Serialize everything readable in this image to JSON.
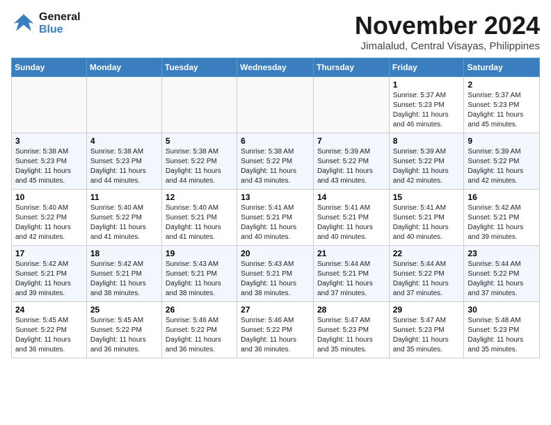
{
  "logo": {
    "line1": "General",
    "line2": "Blue"
  },
  "title": "November 2024",
  "subtitle": "Jimalalud, Central Visayas, Philippines",
  "days_of_week": [
    "Sunday",
    "Monday",
    "Tuesday",
    "Wednesday",
    "Thursday",
    "Friday",
    "Saturday"
  ],
  "weeks": [
    [
      {
        "day": "",
        "info": ""
      },
      {
        "day": "",
        "info": ""
      },
      {
        "day": "",
        "info": ""
      },
      {
        "day": "",
        "info": ""
      },
      {
        "day": "",
        "info": ""
      },
      {
        "day": "1",
        "info": "Sunrise: 5:37 AM\nSunset: 5:23 PM\nDaylight: 11 hours and 46 minutes."
      },
      {
        "day": "2",
        "info": "Sunrise: 5:37 AM\nSunset: 5:23 PM\nDaylight: 11 hours and 45 minutes."
      }
    ],
    [
      {
        "day": "3",
        "info": "Sunrise: 5:38 AM\nSunset: 5:23 PM\nDaylight: 11 hours and 45 minutes."
      },
      {
        "day": "4",
        "info": "Sunrise: 5:38 AM\nSunset: 5:23 PM\nDaylight: 11 hours and 44 minutes."
      },
      {
        "day": "5",
        "info": "Sunrise: 5:38 AM\nSunset: 5:22 PM\nDaylight: 11 hours and 44 minutes."
      },
      {
        "day": "6",
        "info": "Sunrise: 5:38 AM\nSunset: 5:22 PM\nDaylight: 11 hours and 43 minutes."
      },
      {
        "day": "7",
        "info": "Sunrise: 5:39 AM\nSunset: 5:22 PM\nDaylight: 11 hours and 43 minutes."
      },
      {
        "day": "8",
        "info": "Sunrise: 5:39 AM\nSunset: 5:22 PM\nDaylight: 11 hours and 42 minutes."
      },
      {
        "day": "9",
        "info": "Sunrise: 5:39 AM\nSunset: 5:22 PM\nDaylight: 11 hours and 42 minutes."
      }
    ],
    [
      {
        "day": "10",
        "info": "Sunrise: 5:40 AM\nSunset: 5:22 PM\nDaylight: 11 hours and 42 minutes."
      },
      {
        "day": "11",
        "info": "Sunrise: 5:40 AM\nSunset: 5:22 PM\nDaylight: 11 hours and 41 minutes."
      },
      {
        "day": "12",
        "info": "Sunrise: 5:40 AM\nSunset: 5:21 PM\nDaylight: 11 hours and 41 minutes."
      },
      {
        "day": "13",
        "info": "Sunrise: 5:41 AM\nSunset: 5:21 PM\nDaylight: 11 hours and 40 minutes."
      },
      {
        "day": "14",
        "info": "Sunrise: 5:41 AM\nSunset: 5:21 PM\nDaylight: 11 hours and 40 minutes."
      },
      {
        "day": "15",
        "info": "Sunrise: 5:41 AM\nSunset: 5:21 PM\nDaylight: 11 hours and 40 minutes."
      },
      {
        "day": "16",
        "info": "Sunrise: 5:42 AM\nSunset: 5:21 PM\nDaylight: 11 hours and 39 minutes."
      }
    ],
    [
      {
        "day": "17",
        "info": "Sunrise: 5:42 AM\nSunset: 5:21 PM\nDaylight: 11 hours and 39 minutes."
      },
      {
        "day": "18",
        "info": "Sunrise: 5:42 AM\nSunset: 5:21 PM\nDaylight: 11 hours and 38 minutes."
      },
      {
        "day": "19",
        "info": "Sunrise: 5:43 AM\nSunset: 5:21 PM\nDaylight: 11 hours and 38 minutes."
      },
      {
        "day": "20",
        "info": "Sunrise: 5:43 AM\nSunset: 5:21 PM\nDaylight: 11 hours and 38 minutes."
      },
      {
        "day": "21",
        "info": "Sunrise: 5:44 AM\nSunset: 5:21 PM\nDaylight: 11 hours and 37 minutes."
      },
      {
        "day": "22",
        "info": "Sunrise: 5:44 AM\nSunset: 5:22 PM\nDaylight: 11 hours and 37 minutes."
      },
      {
        "day": "23",
        "info": "Sunrise: 5:44 AM\nSunset: 5:22 PM\nDaylight: 11 hours and 37 minutes."
      }
    ],
    [
      {
        "day": "24",
        "info": "Sunrise: 5:45 AM\nSunset: 5:22 PM\nDaylight: 11 hours and 36 minutes."
      },
      {
        "day": "25",
        "info": "Sunrise: 5:45 AM\nSunset: 5:22 PM\nDaylight: 11 hours and 36 minutes."
      },
      {
        "day": "26",
        "info": "Sunrise: 5:46 AM\nSunset: 5:22 PM\nDaylight: 11 hours and 36 minutes."
      },
      {
        "day": "27",
        "info": "Sunrise: 5:46 AM\nSunset: 5:22 PM\nDaylight: 11 hours and 36 minutes."
      },
      {
        "day": "28",
        "info": "Sunrise: 5:47 AM\nSunset: 5:23 PM\nDaylight: 11 hours and 35 minutes."
      },
      {
        "day": "29",
        "info": "Sunrise: 5:47 AM\nSunset: 5:23 PM\nDaylight: 11 hours and 35 minutes."
      },
      {
        "day": "30",
        "info": "Sunrise: 5:48 AM\nSunset: 5:23 PM\nDaylight: 11 hours and 35 minutes."
      }
    ]
  ]
}
